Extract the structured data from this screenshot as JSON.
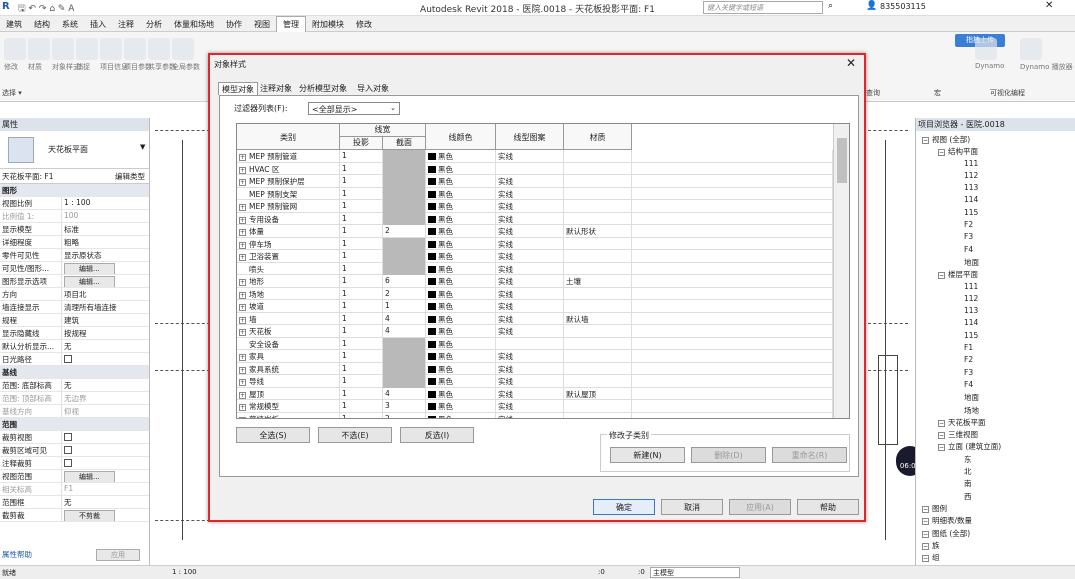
{
  "app": {
    "title": "Autodesk Revit 2018 -   医院.0018 - 天花板投影平面: F1",
    "search_placeholder": "键入关键字或短语",
    "user": "835503115",
    "share": "指拽上传",
    "time": "06:05"
  },
  "menu": [
    "建筑",
    "结构",
    "系统",
    "插入",
    "注释",
    "分析",
    "体量和场地",
    "协作",
    "视图",
    "管理",
    "附加模块",
    "修改"
  ],
  "menu_active": "管理",
  "ribbon": {
    "labels": [
      "修改",
      "材质",
      "对象样式",
      "捕捉",
      "项目信息",
      "项目参数",
      "共享参数",
      "全局参数"
    ],
    "right": [
      "Dynamo",
      "Dynamo 播放器"
    ],
    "groups": [
      "选择 ▾",
      "查询",
      "宏",
      "可视化编程"
    ]
  },
  "props": {
    "title": "属性",
    "type": "天花板平面",
    "instance": "天花板平面: F1",
    "edit_type": "编辑类型",
    "rows": [
      {
        "g": "图形"
      },
      {
        "k": "视图比例",
        "v": "1 : 100"
      },
      {
        "k": "比例值 1:",
        "v": "100",
        "dim": true
      },
      {
        "k": "显示模型",
        "v": "标准"
      },
      {
        "k": "详细程度",
        "v": "粗略"
      },
      {
        "k": "零件可见性",
        "v": "显示原状态"
      },
      {
        "k": "可见性/图形...",
        "b": "编辑..."
      },
      {
        "k": "图形显示选项",
        "b": "编辑..."
      },
      {
        "k": "方向",
        "v": "项目北"
      },
      {
        "k": "墙连接显示",
        "v": "清理所有墙连接"
      },
      {
        "k": "规程",
        "v": "建筑"
      },
      {
        "k": "显示隐藏线",
        "v": "按规程"
      },
      {
        "k": "默认分析显示...",
        "v": "无"
      },
      {
        "k": "日光路径",
        "cb": true
      },
      {
        "g": "基线"
      },
      {
        "k": "范围: 底部标高",
        "v": "无"
      },
      {
        "k": "范围: 顶部标高",
        "v": "无边界",
        "dim": true
      },
      {
        "k": "基线方向",
        "v": "仰视",
        "dim": true
      },
      {
        "g": "范围"
      },
      {
        "k": "裁剪视图",
        "cb": true
      },
      {
        "k": "裁剪区域可见",
        "cb": true
      },
      {
        "k": "注释裁剪",
        "cb": true
      },
      {
        "k": "视图范围",
        "b": "编辑..."
      },
      {
        "k": "相关标高",
        "v": "F1",
        "dim": true
      },
      {
        "k": "范围框",
        "v": "无"
      },
      {
        "k": "截剪裁",
        "b": "不剪裁"
      }
    ],
    "help": "属性帮助",
    "apply": "应用"
  },
  "browser": {
    "title": "项目浏览器 - 医院.0018",
    "items": [
      {
        "t": "视图 (全部)",
        "l": 0
      },
      {
        "t": "结构平面",
        "l": 1
      },
      {
        "t": "111",
        "l": 2
      },
      {
        "t": "112",
        "l": 2
      },
      {
        "t": "113",
        "l": 2
      },
      {
        "t": "114",
        "l": 2
      },
      {
        "t": "115",
        "l": 2
      },
      {
        "t": "F2",
        "l": 2
      },
      {
        "t": "F3",
        "l": 2
      },
      {
        "t": "F4",
        "l": 2
      },
      {
        "t": "地面",
        "l": 2
      },
      {
        "t": "楼层平面",
        "l": 1
      },
      {
        "t": "111",
        "l": 2
      },
      {
        "t": "112",
        "l": 2
      },
      {
        "t": "113",
        "l": 2
      },
      {
        "t": "114",
        "l": 2
      },
      {
        "t": "115",
        "l": 2
      },
      {
        "t": "F1",
        "l": 2
      },
      {
        "t": "F2",
        "l": 2
      },
      {
        "t": "F3",
        "l": 2
      },
      {
        "t": "F4",
        "l": 2
      },
      {
        "t": "地面",
        "l": 2
      },
      {
        "t": "场地",
        "l": 2
      },
      {
        "t": "天花板平面",
        "l": 1
      },
      {
        "t": "三维视图",
        "l": 1
      },
      {
        "t": "立面 (建筑立面)",
        "l": 1
      },
      {
        "t": "东",
        "l": 2
      },
      {
        "t": "北",
        "l": 2
      },
      {
        "t": "南",
        "l": 2
      },
      {
        "t": "西",
        "l": 2
      },
      {
        "t": "图例",
        "l": 0
      },
      {
        "t": "明细表/数量",
        "l": 0
      },
      {
        "t": "图纸 (全部)",
        "l": 0
      },
      {
        "t": "族",
        "l": 0
      },
      {
        "t": "组",
        "l": 0
      }
    ]
  },
  "status": {
    "left": "就绪",
    "scale": "1 : 100",
    "zero1": ":0",
    "zero2": ":0",
    "model": "主模型"
  },
  "dialog": {
    "title": "对象样式",
    "tabs": [
      "模型对象",
      "注释对象",
      "分析模型对象",
      "导入对象"
    ],
    "filter_label": "过滤器列表(F):",
    "filter_value": "<全部显示>",
    "headers": {
      "category": "类别",
      "lineweight": "线宽",
      "projection": "投影",
      "cut": "截面",
      "color": "线颜色",
      "pattern": "线型图案",
      "material": "材质"
    },
    "rows": [
      {
        "n": "MEP 预制管道",
        "p": "1",
        "cut": "",
        "g": true,
        "col": "黑色",
        "pat": "实线",
        "m": "",
        "plus": true
      },
      {
        "n": "HVAC 区",
        "p": "1",
        "cut": "",
        "g": true,
        "col": "黑色",
        "pat": "",
        "m": "",
        "plus": true
      },
      {
        "n": "MEP 预制保护层",
        "p": "1",
        "cut": "",
        "g": true,
        "col": "黑色",
        "pat": "实线",
        "m": "",
        "plus": true
      },
      {
        "n": "MEP 预制支架",
        "p": "1",
        "cut": "",
        "g": true,
        "col": "黑色",
        "pat": "实线",
        "m": "",
        "plus": false
      },
      {
        "n": "MEP 预制管网",
        "p": "1",
        "cut": "",
        "g": true,
        "col": "黑色",
        "pat": "实线",
        "m": "",
        "plus": true
      },
      {
        "n": "专用设备",
        "p": "1",
        "cut": "",
        "g": true,
        "col": "黑色",
        "pat": "实线",
        "m": "",
        "plus": true
      },
      {
        "n": "体量",
        "p": "1",
        "cut": "2",
        "g": false,
        "col": "黑色",
        "pat": "实线",
        "m": "默认形状",
        "plus": true
      },
      {
        "n": "停车场",
        "p": "1",
        "cut": "",
        "g": true,
        "col": "黑色",
        "pat": "实线",
        "m": "",
        "plus": true
      },
      {
        "n": "卫浴装置",
        "p": "1",
        "cut": "",
        "g": true,
        "col": "黑色",
        "pat": "实线",
        "m": "",
        "plus": true
      },
      {
        "n": "喷头",
        "p": "1",
        "cut": "",
        "g": true,
        "col": "黑色",
        "pat": "实线",
        "m": "",
        "plus": false
      },
      {
        "n": "地形",
        "p": "1",
        "cut": "6",
        "g": false,
        "col": "黑色",
        "pat": "实线",
        "m": "土壤",
        "plus": true
      },
      {
        "n": "场地",
        "p": "1",
        "cut": "2",
        "g": false,
        "col": "黑色",
        "pat": "实线",
        "m": "",
        "plus": true
      },
      {
        "n": "坡道",
        "p": "1",
        "cut": "1",
        "g": false,
        "col": "黑色",
        "pat": "实线",
        "m": "",
        "plus": true
      },
      {
        "n": "墙",
        "p": "1",
        "cut": "4",
        "g": false,
        "col": "黑色",
        "pat": "实线",
        "m": "默认墙",
        "plus": true
      },
      {
        "n": "天花板",
        "p": "1",
        "cut": "4",
        "g": false,
        "col": "黑色",
        "pat": "实线",
        "m": "",
        "plus": true
      },
      {
        "n": "安全设备",
        "p": "1",
        "cut": "",
        "g": true,
        "col": "黑色",
        "pat": "",
        "m": "",
        "plus": false
      },
      {
        "n": "家具",
        "p": "1",
        "cut": "",
        "g": true,
        "col": "黑色",
        "pat": "实线",
        "m": "",
        "plus": true
      },
      {
        "n": "家具系统",
        "p": "1",
        "cut": "",
        "g": true,
        "col": "黑色",
        "pat": "实线",
        "m": "",
        "plus": true
      },
      {
        "n": "导线",
        "p": "1",
        "cut": "",
        "g": true,
        "col": "黑色",
        "pat": "实线",
        "m": "",
        "plus": true
      },
      {
        "n": "屋顶",
        "p": "1",
        "cut": "4",
        "g": false,
        "col": "黑色",
        "pat": "实线",
        "m": "默认屋顶",
        "plus": true
      },
      {
        "n": "常规模型",
        "p": "1",
        "cut": "3",
        "g": false,
        "col": "黑色",
        "pat": "实线",
        "m": "",
        "plus": true
      },
      {
        "n": "幕墙嵌板",
        "p": "1",
        "cut": "2",
        "g": false,
        "col": "黑色",
        "pat": "实线",
        "m": "",
        "plus": true
      }
    ],
    "btn_all": "全选(S)",
    "btn_none": "不选(E)",
    "btn_invert": "反选(I)",
    "subcat_label": "修改子类别",
    "btn_new": "新建(N)",
    "btn_delete": "删除(D)",
    "btn_rename": "重命名(R)",
    "btn_ok": "确定",
    "btn_cancel": "取消",
    "btn_apply": "应用(A)",
    "btn_help": "帮助"
  }
}
